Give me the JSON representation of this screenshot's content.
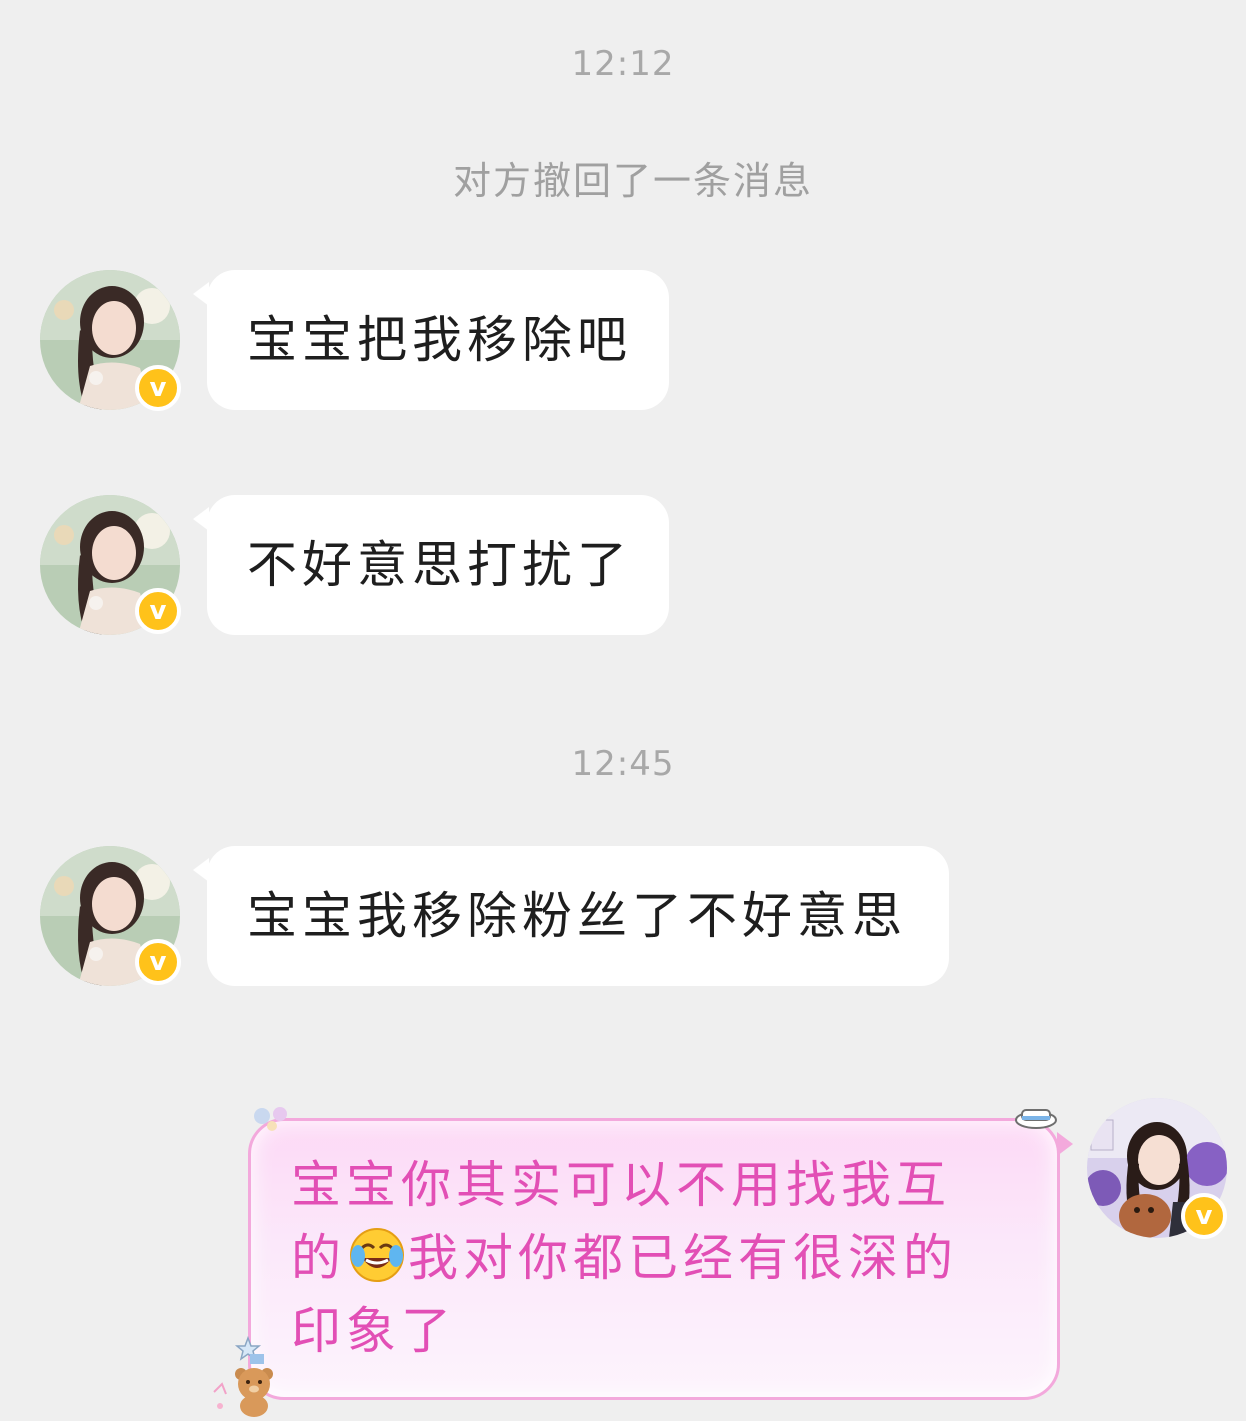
{
  "chat": {
    "timestamps": [
      "12:12",
      "12:45"
    ],
    "system_note": "对方撤回了一条消息",
    "messages": [
      {
        "sender": "other",
        "text": "宝宝把我移除吧"
      },
      {
        "sender": "other",
        "text": "不好意思打扰了"
      },
      {
        "sender": "other",
        "text": "宝宝我移除粉丝了不好意思"
      },
      {
        "sender": "self",
        "text_line1": "宝宝你其实可以不用找我互",
        "text_line2_a": "的",
        "emoji": "face-with-tears-of-joy-icon",
        "text_line2_b": "我对你都已经有很深的",
        "text_line3": "印象了"
      }
    ]
  },
  "badges": {
    "verified_label": "v"
  },
  "colors": {
    "background": "#efefef",
    "bubble_other": "#ffffff",
    "bubble_self_text": "#e24fb5",
    "bubble_self_border": "#f3a9dc",
    "verified_badge": "#ffc21a"
  }
}
